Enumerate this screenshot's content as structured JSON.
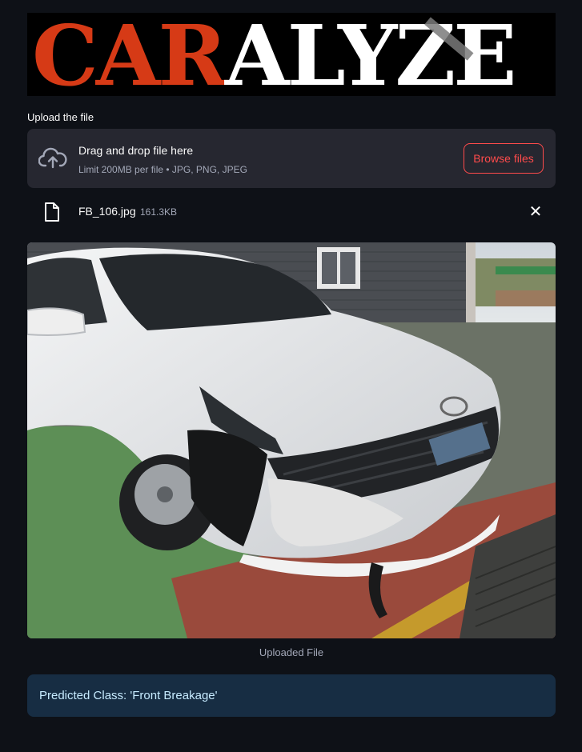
{
  "logo": {
    "part1": "CAR",
    "part2": "ALYZE",
    "alt_icon": "caralyze-logo"
  },
  "uploader": {
    "label": "Upload the file",
    "drop_title": "Drag and drop file here",
    "drop_limit": "Limit 200MB per file • JPG, PNG, JPEG",
    "browse_label": "Browse files",
    "icon": "cloud-upload-icon"
  },
  "file": {
    "name": "FB_106.jpg",
    "size": "161.3KB",
    "icon": "file-icon",
    "remove_icon": "close-icon",
    "remove_glyph": "✕"
  },
  "image": {
    "caption": "Uploaded File"
  },
  "prediction": {
    "text": "Predicted Class: 'Front Breakage'"
  },
  "colors": {
    "background": "#0e1117",
    "dropzone": "#262730",
    "accent": "#ff4b4b",
    "info_bg": "#172d43",
    "info_text": "#c7ebff",
    "logo_red": "#d63a16"
  }
}
